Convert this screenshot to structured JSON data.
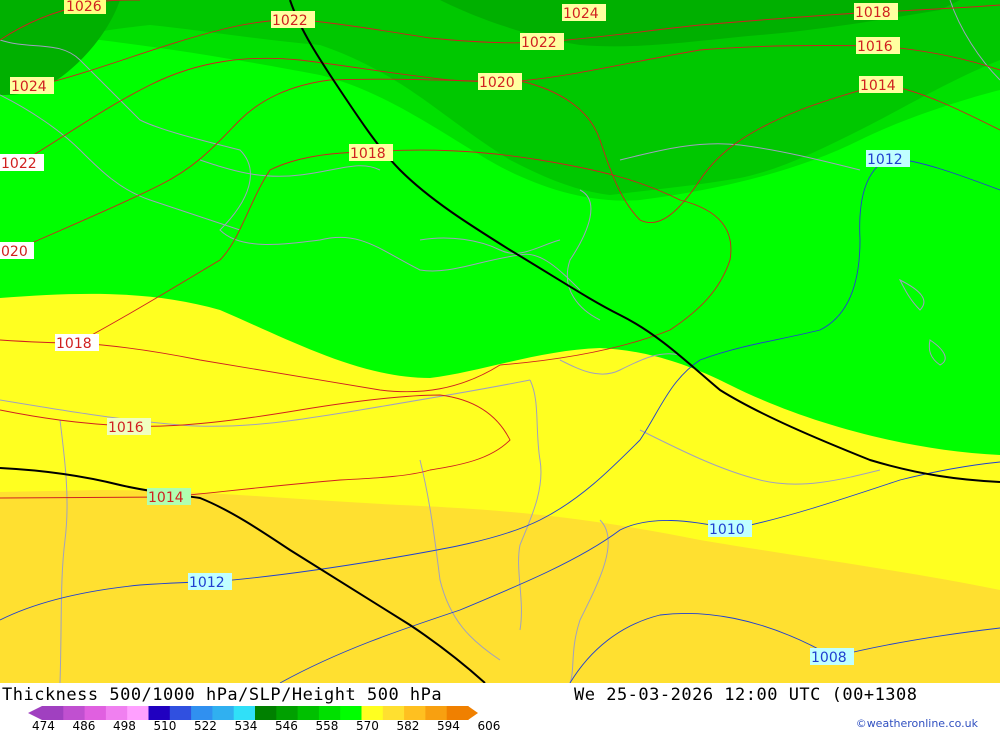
{
  "map": {
    "colors": {
      "green_dark": "#00b000",
      "green_mid": "#00c800",
      "green": "#00e000",
      "green_bright": "#00ff00",
      "yellow": "#ffff20",
      "yellow_dark": "#ffe030",
      "isobar_red": "#d02020",
      "isobar_blue": "#2040d0",
      "height_line": "#000000",
      "border": "#a0a0c0"
    },
    "isobar_labels": [
      {
        "text": "1026",
        "kind": "red"
      },
      {
        "text": "1022",
        "kind": "red"
      },
      {
        "text": "1024",
        "kind": "red"
      },
      {
        "text": "1018",
        "kind": "red"
      },
      {
        "text": "1022",
        "kind": "red"
      },
      {
        "text": "1016",
        "kind": "red"
      },
      {
        "text": "1020",
        "kind": "red"
      },
      {
        "text": "1014",
        "kind": "red"
      },
      {
        "text": "1024",
        "kind": "red"
      },
      {
        "text": "1022",
        "kind": "red"
      },
      {
        "text": "1018",
        "kind": "red"
      },
      {
        "text": "020",
        "kind": "red"
      },
      {
        "text": "1018",
        "kind": "red"
      },
      {
        "text": "1016",
        "kind": "red"
      },
      {
        "text": "1014",
        "kind": "red"
      },
      {
        "text": "1012",
        "kind": "blue"
      },
      {
        "text": "1010",
        "kind": "blue"
      },
      {
        "text": "1012",
        "kind": "blue"
      },
      {
        "text": "1008",
        "kind": "blue"
      }
    ]
  },
  "footer": {
    "title_left": "Thickness 500/1000 hPa/SLP/Height 500 hPa",
    "title_right": "We 25-03-2026 12:00 UTC (00+1308",
    "colorbar": {
      "ticks": [
        "474",
        "486",
        "498",
        "510",
        "522",
        "534",
        "546",
        "558",
        "570",
        "582",
        "594",
        "606"
      ],
      "colors": [
        "#a040c0",
        "#c050d0",
        "#e060e0",
        "#f080f0",
        "#ffa0ff",
        "#2000c0",
        "#3050e0",
        "#3090f0",
        "#30b0f0",
        "#30e0f8",
        "#008000",
        "#00a000",
        "#00c000",
        "#00e000",
        "#00ff00",
        "#ffff20",
        "#ffe030",
        "#ffc020",
        "#f8a010",
        "#f08000"
      ]
    },
    "credit": "©weatheronline.co.uk"
  }
}
